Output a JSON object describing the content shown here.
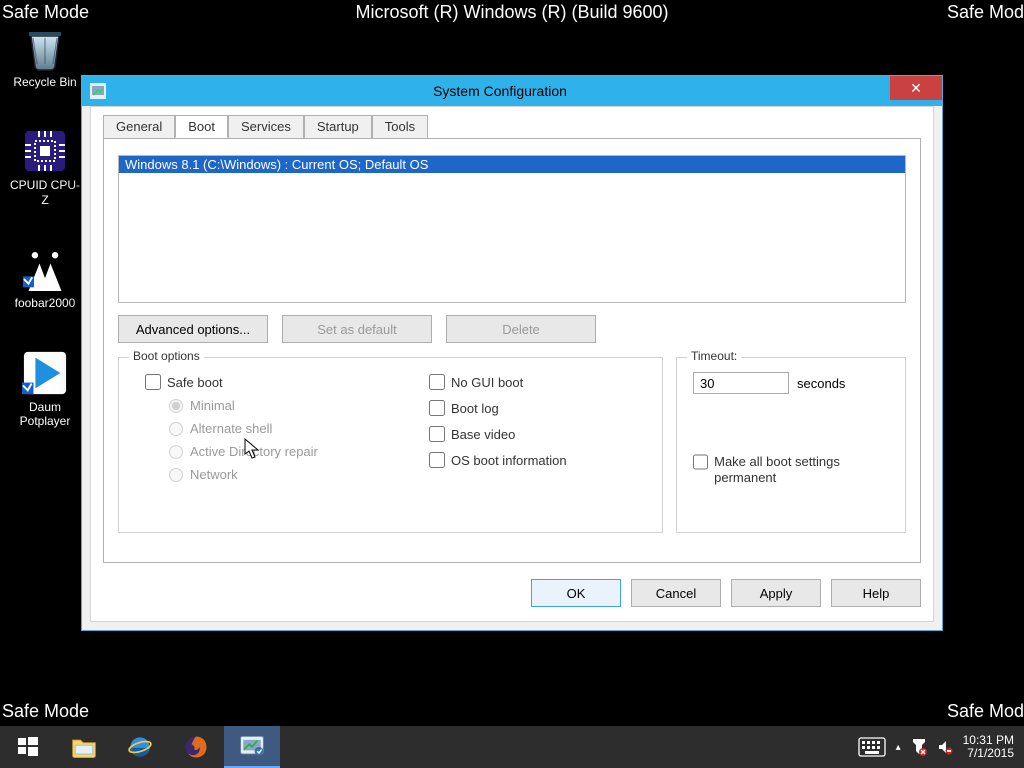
{
  "wallpaper": {
    "top_left": "Safe Mode",
    "top_center": "Microsoft (R) Windows (R) (Build 9600)",
    "top_right": "Safe Mode",
    "bottom_left": "Safe Mode",
    "bottom_right": "Safe Mode"
  },
  "desktop": {
    "icons": [
      {
        "label": "Recycle Bin"
      },
      {
        "label": "CPUID CPU-Z"
      },
      {
        "label": "foobar2000"
      },
      {
        "label": "Daum Potplayer"
      }
    ]
  },
  "dialog": {
    "title": "System Configuration",
    "close_glyph": "✕",
    "tabs": [
      "General",
      "Boot",
      "Services",
      "Startup",
      "Tools"
    ],
    "active_tab": 1,
    "os_list": [
      "Windows 8.1 (C:\\Windows) : Current OS; Default OS"
    ],
    "buttons_row1": {
      "advanced": "Advanced options...",
      "set_default": "Set as default",
      "delete": "Delete"
    },
    "boot_group": {
      "legend": "Boot options",
      "safe_boot": "Safe boot",
      "radios": [
        "Minimal",
        "Alternate shell",
        "Active Directory repair",
        "Network"
      ],
      "checks_right": [
        "No GUI boot",
        "Boot log",
        "Base video",
        "OS boot information"
      ]
    },
    "timeout_group": {
      "legend": "Timeout:",
      "value": "30",
      "unit": "seconds",
      "make_permanent": "Make all boot settings permanent"
    },
    "buttons_row2": {
      "ok": "OK",
      "cancel": "Cancel",
      "apply": "Apply",
      "help": "Help"
    }
  },
  "taskbar": {
    "time": "10:31 PM",
    "date": "7/1/2015",
    "tray_chevron": "▴"
  }
}
